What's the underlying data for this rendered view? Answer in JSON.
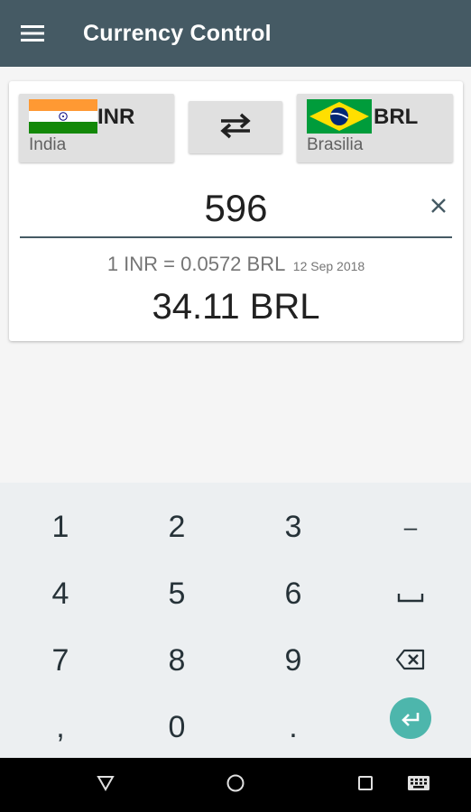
{
  "app": {
    "title": "Currency Control"
  },
  "from_currency": {
    "code": "INR",
    "country": "India",
    "flag_icon": "india-flag-icon"
  },
  "to_currency": {
    "code": "BRL",
    "country": "Brasilia",
    "flag_icon": "brazil-flag-icon"
  },
  "input": {
    "amount": "596"
  },
  "rate": {
    "text": "1 INR = 0.0572 BRL",
    "date": "12 Sep 2018"
  },
  "result": {
    "text": "34.11 BRL"
  },
  "keypad": {
    "keys": [
      "1",
      "2",
      "3",
      "–",
      "4",
      "5",
      "6",
      "␣",
      "7",
      "8",
      "9",
      "⌫",
      ",",
      "0",
      ".",
      "↵"
    ]
  },
  "icons": {
    "menu": "menu-icon",
    "swap": "swap-icon",
    "clear": "close-icon",
    "back": "back-icon",
    "home": "home-icon",
    "recents": "recents-icon",
    "keyboard": "keyboard-icon"
  },
  "colors": {
    "app_bar": "#455a64",
    "card": "#ffffff",
    "currency_button": "#e0e0e0",
    "keyboard_bg": "#eceff1",
    "enter_key": "#4db6ac",
    "nav_bar": "#000000"
  }
}
